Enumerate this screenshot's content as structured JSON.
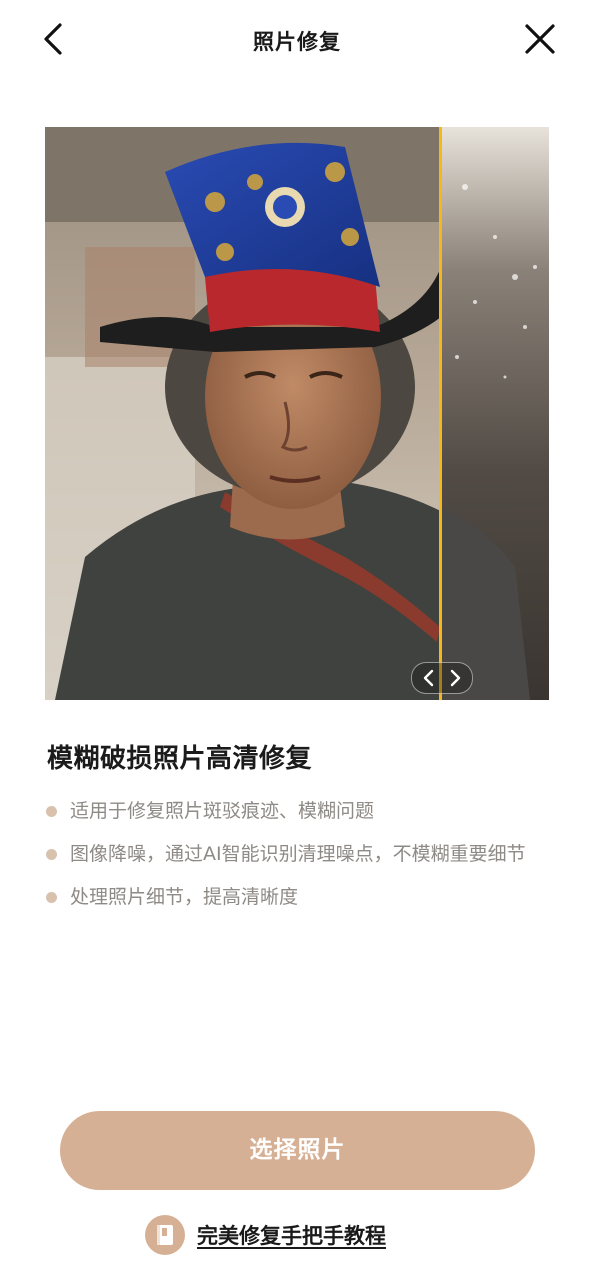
{
  "header": {
    "title": "照片修复",
    "back_icon": "chevron-left-icon",
    "close_icon": "close-icon"
  },
  "preview": {
    "handle_icons": [
      "chevron-left-icon",
      "chevron-right-icon"
    ],
    "divider_color": "#f2b81c"
  },
  "feature": {
    "title": "模糊破损照片高清修复",
    "items": [
      "适用于修复照片斑驳痕迹、模糊问题",
      "图像降噪，通过AI智能识别清理噪点，不模糊重要细节",
      "处理照片细节，提高清晰度"
    ]
  },
  "actions": {
    "select_label": "选择照片",
    "tutorial_label": "完美修复手把手教程",
    "tutorial_icon": "book-icon"
  },
  "colors": {
    "accent": "#d6b094",
    "bullet": "#d8c2ae",
    "muted_text": "#8e8a86"
  }
}
